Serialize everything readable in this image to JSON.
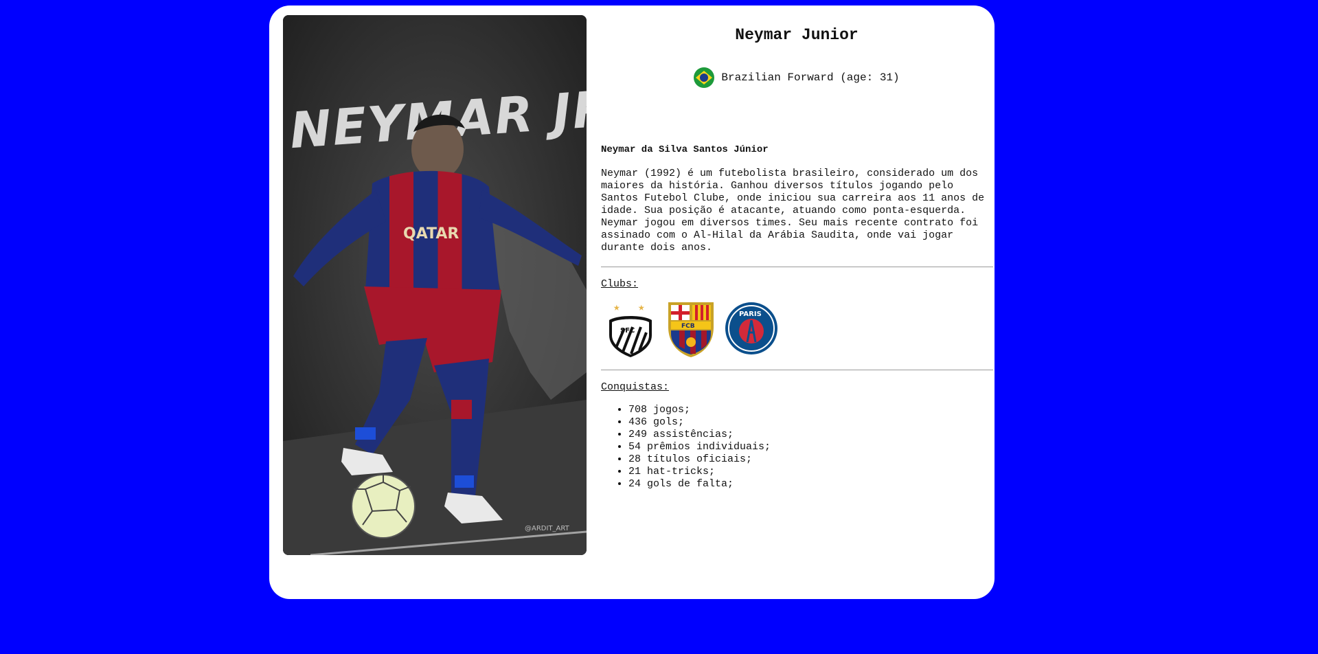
{
  "player": {
    "name": "Neymar Junior",
    "nation_line": "Brazilian Forward (age: 31)",
    "full_name": "Neymar da Silva Santos Júnior",
    "bio": "Neymar (1992) é um futebolista brasileiro, considerado um dos maiores da história. Ganhou diversos títulos jogando pelo Santos Futebol Clube, onde iniciou sua carreira aos 11 anos de idade. Sua posição é atacante, atuando como ponta-esquerda. Neymar jogou em diversos times. Seu mais recente contrato foi assinado com o Al-Hilal da Arábia Saudita, onde vai jogar durante dois anos.",
    "photo_text": "NEYMAR JR",
    "photo_credit": "@ARDIT_ART"
  },
  "clubs": {
    "label": "Clubs:",
    "items": [
      {
        "name": "santos-crest",
        "text": "SFC"
      },
      {
        "name": "barcelona-crest",
        "text": "FCB"
      },
      {
        "name": "psg-crest",
        "text": "PARIS"
      }
    ]
  },
  "achievements": {
    "label": "Conquistas:",
    "items": [
      "708 jogos;",
      "436 gols;",
      "249 assistências;",
      "54 prêmios individuais;",
      "28 títulos oficiais;",
      "21 hat-tricks;",
      "24 gols de falta;"
    ]
  },
  "colors": {
    "page_background": "#0000ff",
    "card_background": "#ffffff",
    "text": "#111111"
  }
}
